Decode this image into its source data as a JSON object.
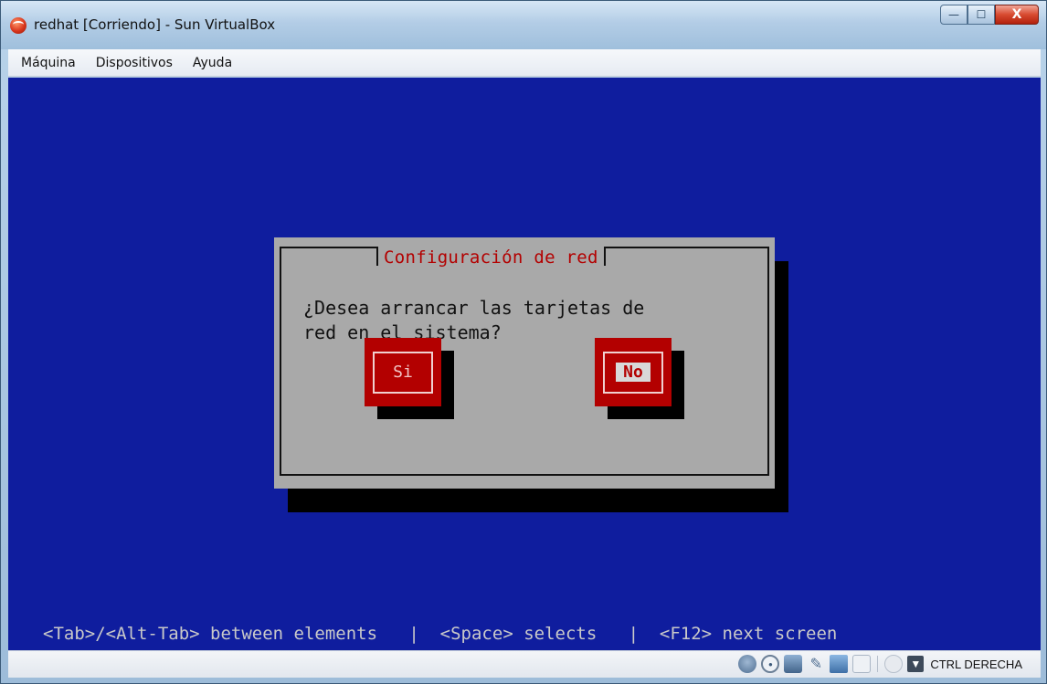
{
  "window": {
    "title": "redhat [Corriendo] - Sun VirtualBox",
    "controls": {
      "minimize": "—",
      "maximize": "☐",
      "close": "X"
    }
  },
  "menubar": {
    "items": [
      {
        "label": "Máquina"
      },
      {
        "label": "Dispositivos"
      },
      {
        "label": "Ayuda"
      }
    ]
  },
  "guest": {
    "dialog": {
      "title": "Configuración de red",
      "message": "¿Desea arrancar las tarjetas de\nred en el sistema?",
      "buttons": {
        "yes": "Si",
        "no": "No"
      },
      "focused_button": "No"
    },
    "help_line": "<Tab>/<Alt-Tab> between elements   |  <Space> selects   |  <F12> next screen",
    "colors": {
      "background": "#0f1d9e",
      "dialog": "#a9a9a9",
      "accent": "#b30000"
    }
  },
  "statusbar": {
    "icons": [
      "hard-disk-icon",
      "optical-drive-icon",
      "network-icon",
      "usb-icon",
      "shared-folder-icon",
      "seamless-icon",
      "mouse-integration-icon",
      "host-key-icon"
    ],
    "host_key": "CTRL DERECHA"
  }
}
